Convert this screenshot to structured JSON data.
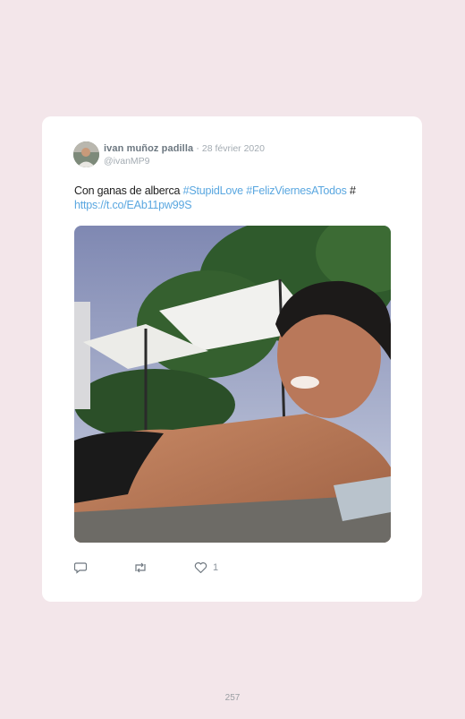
{
  "tweet": {
    "author_name": "ivan muñoz padilla",
    "separator": "·",
    "date": "28 février 2020",
    "handle": "@ivanMP9",
    "text_plain": "Con ganas de alberca",
    "hashtag_1": "#StupidLove",
    "hashtag_2": "#FelizViernesATodos",
    "hashtag_3": "#",
    "link": "https://t.co/EAb11pw99S",
    "likes": "1"
  },
  "icons": {
    "reply": "reply-icon",
    "retweet": "retweet-icon",
    "like": "heart-icon"
  },
  "colors": {
    "background": "#f3e6ea",
    "card": "#ffffff",
    "link": "#5aa7e0",
    "muted": "#9aa3ab"
  },
  "page": {
    "number": "257"
  }
}
